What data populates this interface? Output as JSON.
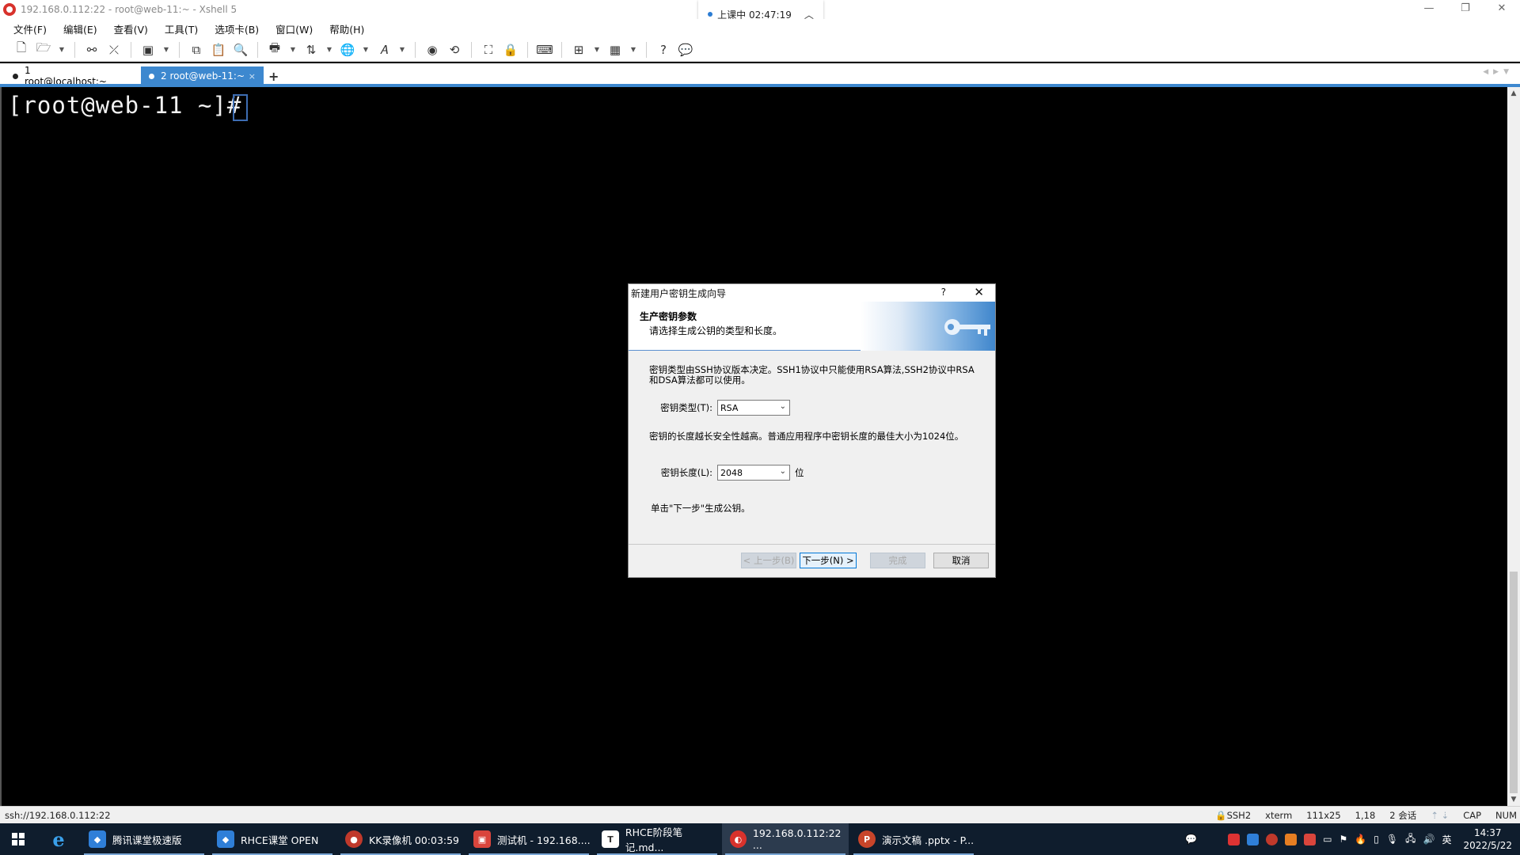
{
  "window": {
    "title": "192.168.0.112:22 - root@web-11:~ - Xshell 5",
    "controls": [
      "—",
      "❐",
      "✕"
    ]
  },
  "class_status": {
    "text": "上课中 02:47:19"
  },
  "menu": [
    "文件(F)",
    "编辑(E)",
    "查看(V)",
    "工具(T)",
    "选项卡(B)",
    "窗口(W)",
    "帮助(H)"
  ],
  "tabs": [
    {
      "label": "1 root@localhost:~"
    },
    {
      "label": "2 root@web-11:~",
      "close": "×"
    }
  ],
  "tab_add": "+",
  "terminal": {
    "prompt": "[root@web-11 ~]#"
  },
  "dialog": {
    "title": "新建用户密钥生成向导",
    "help": "?",
    "close": "✕",
    "heading": "生产密钥参数",
    "subheading": "请选择生成公钥的类型和长度。",
    "desc1": "密钥类型由SSH协议版本决定。SSH1协议中只能使用RSA算法,SSH2协议中RSA和DSA算法都可以使用。",
    "key_type_label": "密钥类型(T):",
    "key_type_value": "RSA",
    "desc2": "密钥的长度越长安全性越高。普通应用程序中密钥长度的最佳大小为1024位。",
    "key_length_label": "密钥长度(L):",
    "key_length_value": "2048",
    "key_length_unit": "位",
    "instruction": "单击\"下一步\"生成公钥。",
    "buttons": {
      "back": "< 上一步(B)",
      "next": "下一步(N) >",
      "finish": "完成",
      "cancel": "取消"
    }
  },
  "statusbar": {
    "connection": "ssh://192.168.0.112:22",
    "protocol": "SSH2",
    "term": "xterm",
    "size": "111x25",
    "position": "1,18",
    "sessions": "2 会话",
    "caps": "CAP",
    "num": "NUM"
  },
  "taskbar": {
    "items": [
      {
        "label": "腾讯课堂极速版",
        "icon_color": "#2f7fd8"
      },
      {
        "label": "RHCE课堂 OPEN",
        "icon_color": "#2f7fd8"
      },
      {
        "label": "KK录像机 00:03:59",
        "icon_color": "#c0392b"
      },
      {
        "label": "测试机 - 192.168....",
        "icon_color": "#d9453c"
      },
      {
        "label": "RHCE阶段笔记.md...",
        "icon_color": "#555555"
      },
      {
        "label": "192.168.0.112:22 ...",
        "icon_color": "#d8322c"
      },
      {
        "label": "演示文稿 .pptx - P...",
        "icon_color": "#c8452a"
      }
    ],
    "ime": "英",
    "time": "14:37",
    "date": "2022/5/22"
  },
  "colors": {
    "accent": "#3d88cf",
    "terminal_bg": "#000000",
    "taskbar_bg": "#0f1d2d"
  }
}
